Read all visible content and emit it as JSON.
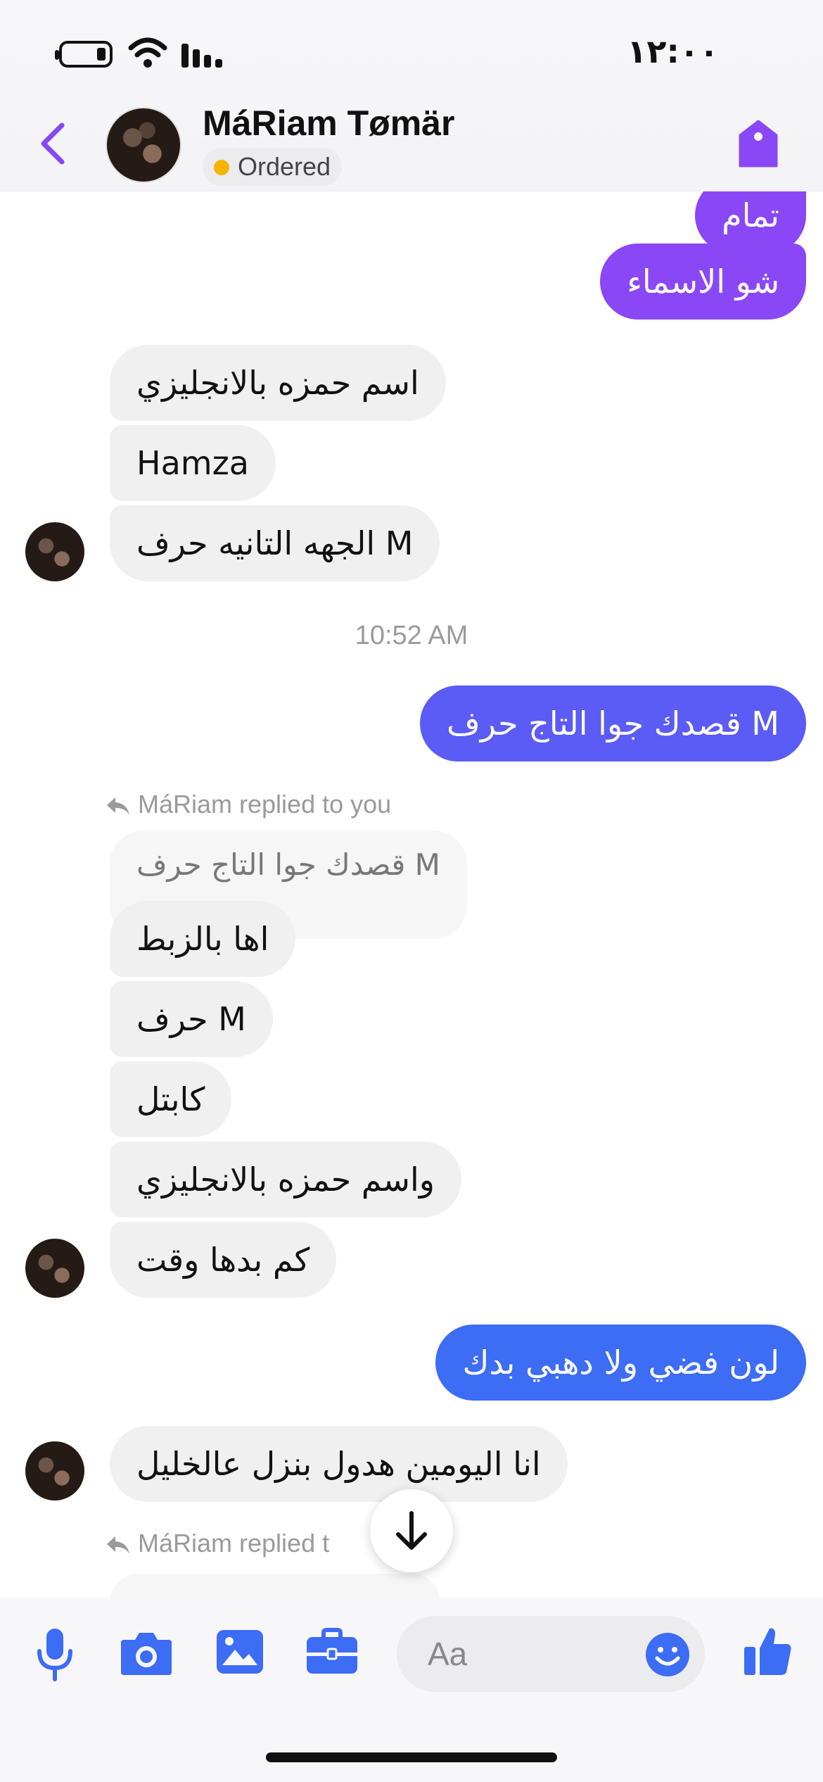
{
  "status_bar": {
    "time": "١٢:٠٠"
  },
  "header": {
    "contact_name": "MáRiam Tømär",
    "order_status": "Ordered"
  },
  "messages": [
    {
      "id": "m1",
      "direction": "out",
      "text": "تمام",
      "color": "#8a47f5"
    },
    {
      "id": "m2",
      "direction": "out",
      "text": "شو الاسماء",
      "color": "#8a47f5"
    },
    {
      "id": "m3",
      "direction": "in",
      "text": "اسم حمزه بالانجليزي"
    },
    {
      "id": "m4",
      "direction": "in",
      "text": "Hamza"
    },
    {
      "id": "m5",
      "direction": "in",
      "text": "الجهه التانيه حرف M"
    },
    {
      "id": "m6",
      "direction": "out",
      "text": "قصدك جوا التاج حرف M",
      "color": "#5b5bf5"
    },
    {
      "id": "m7",
      "direction": "in",
      "text": "اها بالزبط"
    },
    {
      "id": "m8",
      "direction": "in",
      "text": "حرف M"
    },
    {
      "id": "m9",
      "direction": "in",
      "text": "كابتل"
    },
    {
      "id": "m10",
      "direction": "in",
      "text": "واسم حمزه بالانجليزي"
    },
    {
      "id": "m11",
      "direction": "in",
      "text": "كم  بدها وقت"
    },
    {
      "id": "m12",
      "direction": "out",
      "text": "لون فضي ولا دهبي بدك",
      "color": "#3d6cf5"
    },
    {
      "id": "m13",
      "direction": "in",
      "text": "انا اليومين هدول بنزل عالخليل"
    }
  ],
  "timestamp": "10:52 AM",
  "reply_1": {
    "label": "MáRiam replied to you",
    "quoted_text": "قصدك جوا التاج حرف M"
  },
  "reply_2": {
    "label": "MáRiam replied t"
  },
  "composer": {
    "placeholder": "Aa"
  },
  "colors": {
    "accent_purple": "#8a47f5",
    "accent_blue": "#3d6cf5",
    "incoming_bg": "#f0f0f0"
  },
  "icons": [
    "back-chevron-icon",
    "tag-icon",
    "microphone-icon",
    "camera-icon",
    "gallery-icon",
    "briefcase-icon",
    "emoji-icon",
    "thumbs-up-icon",
    "arrow-down-icon",
    "reply-arrow-icon"
  ]
}
